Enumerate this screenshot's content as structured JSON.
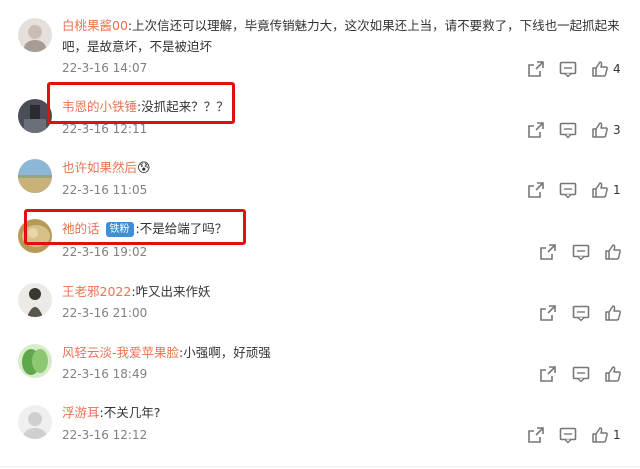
{
  "comments": [
    {
      "user": "白桃果酱00",
      "text": ":上次信还可以理解，毕竟传销魅力大，这次如果还上当，请不要救了，下线也一起抓起来",
      "text2": "吧，是故意坏，不是被迫坏",
      "time": "22-3-16 14:07",
      "likes": "4"
    },
    {
      "user": "韦恩的小铁锤",
      "text": ":没抓起来？？？",
      "time": "22-3-16 12:11",
      "likes": "3"
    },
    {
      "user": "也许如果然后",
      "emoji": "😰",
      "time": "22-3-16 11:05",
      "likes": "1"
    },
    {
      "user": "祂的话",
      "badge": "铁粉",
      "text": ":不是给端了吗？",
      "time": "22-3-16 19:02",
      "likes": ""
    },
    {
      "user": "王老邪2022",
      "text": ":咋又出来作妖",
      "time": "22-3-16 21:00",
      "likes": ""
    },
    {
      "user": "风轻云淡-我爱苹果脸",
      "text": ":小强啊，好顽强",
      "time": "22-3-16 18:49",
      "likes": ""
    },
    {
      "user": "浮游耳",
      "text": ":不关几年?",
      "time": "22-3-16 12:12",
      "likes": "1"
    }
  ],
  "icons": {
    "share": "share-icon",
    "comment": "comment-icon",
    "like": "thumbs-up-icon"
  },
  "colors": {
    "username": "#eb7350",
    "highlight": "#e01010",
    "badge": "#3f8fd6"
  }
}
